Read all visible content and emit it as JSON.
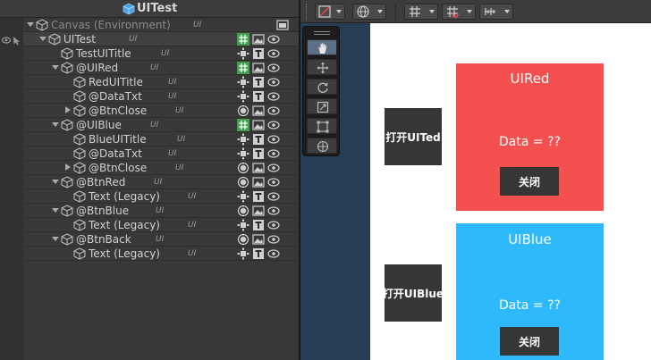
{
  "hierarchy": {
    "title": "UITest",
    "rows": [
      {
        "name": "Canvas (Environment)",
        "tag": "UI"
      },
      {
        "name": "UITest",
        "tag": "UI"
      },
      {
        "name": "TestUITitle",
        "tag": "UI"
      },
      {
        "name": "@UIRed",
        "tag": "UI"
      },
      {
        "name": "RedUITitle",
        "tag": "UI"
      },
      {
        "name": "@DataTxt",
        "tag": "UI"
      },
      {
        "name": "@BtnClose",
        "tag": "UI"
      },
      {
        "name": "@UIBlue",
        "tag": "UI"
      },
      {
        "name": "BlueUITitle",
        "tag": "UI"
      },
      {
        "name": "@DataTxt",
        "tag": "UI"
      },
      {
        "name": "@BtnClose",
        "tag": "UI"
      },
      {
        "name": "@BtnRed",
        "tag": "UI"
      },
      {
        "name": "Text (Legacy)",
        "tag": "UI"
      },
      {
        "name": "@BtnBlue",
        "tag": "UI"
      },
      {
        "name": "Text (Legacy)",
        "tag": "UI"
      },
      {
        "name": "@BtnBack",
        "tag": "UI"
      },
      {
        "name": "Text (Legacy)",
        "tag": "UI"
      }
    ]
  },
  "game": {
    "btn_open_red": "打开UITed",
    "btn_open_blue": "打开UIBlue",
    "red_panel": {
      "title": "UIRed",
      "data": "Data = ??",
      "close": "关闭",
      "color": "#f55050"
    },
    "blue_panel": {
      "title": "UIBlue",
      "data": "Data = ??",
      "close": "关闭",
      "color": "#2eb9fb"
    }
  },
  "colors": {
    "scene_bg": "#263d53",
    "hierarchy_bg": "#383838",
    "selected_row": "#404040"
  }
}
